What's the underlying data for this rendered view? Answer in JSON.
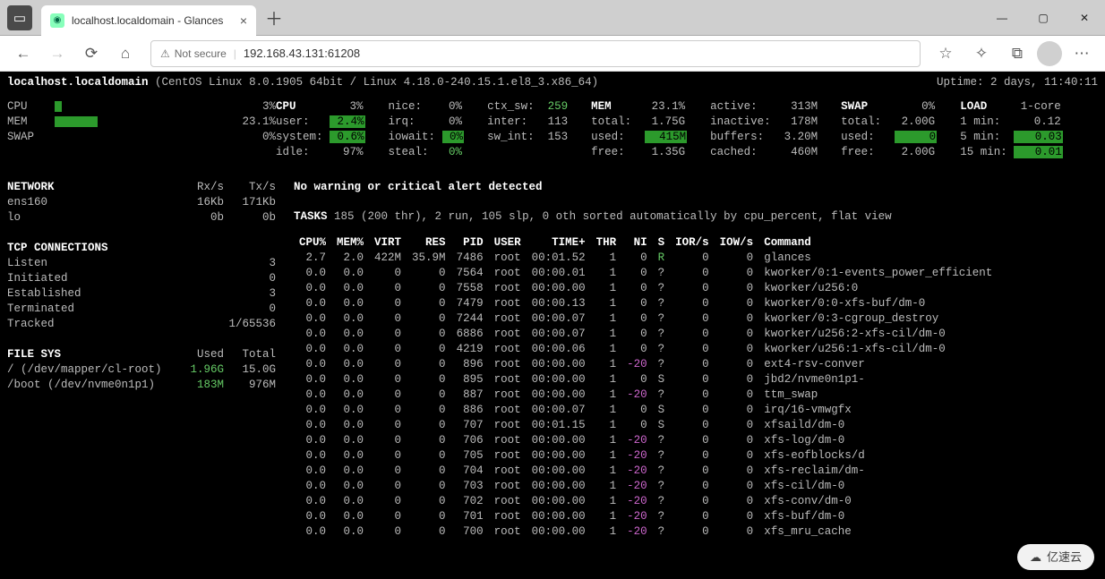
{
  "browser": {
    "tab_title": "localhost.localdomain - Glances",
    "not_secure_label": "Not secure",
    "url": "192.168.43.131:61208"
  },
  "header": {
    "hostname": "localhost.localdomain",
    "os": "(CentOS Linux 8.0.1905 64bit / Linux 4.18.0-240.15.1.el8_3.x86_64)",
    "uptime_label": "Uptime:",
    "uptime_value": "2 days, 11:40:11"
  },
  "summary_left": {
    "cpu_label": "CPU",
    "cpu_pct": "3%",
    "mem_label": "MEM",
    "mem_pct": "23.1%",
    "swap_label": "SWAP",
    "swap_pct": "0%"
  },
  "cpu_block": {
    "title": "CPU",
    "title_val": "3%",
    "rows": [
      {
        "l": "user:",
        "v": "2.4%",
        "hl": true
      },
      {
        "l": "system:",
        "v": "0.6%",
        "hl": true
      },
      {
        "l": "idle:",
        "v": "97%"
      }
    ]
  },
  "cpu_block2": {
    "rows": [
      {
        "l": "nice:",
        "v": "0%"
      },
      {
        "l": "irq:",
        "v": "0%"
      },
      {
        "l": "iowait:",
        "v": "0%",
        "hl": true
      },
      {
        "l": "steal:",
        "v": "0%",
        "green": true
      }
    ]
  },
  "cpu_block3": {
    "rows": [
      {
        "l": "ctx_sw:",
        "v": "259",
        "green": true
      },
      {
        "l": "inter:",
        "v": "113"
      },
      {
        "l": "sw_int:",
        "v": "153"
      }
    ]
  },
  "mem_block": {
    "title": "MEM",
    "title_val": "23.1%",
    "rows": [
      {
        "l": "total:",
        "v": "1.75G"
      },
      {
        "l": "used:",
        "v": "415M",
        "hl": true
      },
      {
        "l": "free:",
        "v": "1.35G"
      }
    ]
  },
  "mem_block2": {
    "rows": [
      {
        "l": "active:",
        "v": "313M"
      },
      {
        "l": "inactive:",
        "v": "178M"
      },
      {
        "l": "buffers:",
        "v": "3.20M"
      },
      {
        "l": "cached:",
        "v": "460M"
      }
    ]
  },
  "swap_block": {
    "title": "SWAP",
    "title_val": "0%",
    "rows": [
      {
        "l": "total:",
        "v": "2.00G"
      },
      {
        "l": "used:",
        "v": "0",
        "hl": true
      },
      {
        "l": "free:",
        "v": "2.00G"
      }
    ]
  },
  "load_block": {
    "title": "LOAD",
    "title_val": "1-core",
    "rows": [
      {
        "l": "1 min:",
        "v": "0.12"
      },
      {
        "l": "5 min:",
        "v": "0.03",
        "hl": true
      },
      {
        "l": "15 min:",
        "v": "0.01",
        "hl": true
      }
    ]
  },
  "network": {
    "title": "NETWORK",
    "col_rx": "Rx/s",
    "col_tx": "Tx/s",
    "rows": [
      {
        "if": "ens160",
        "rx": "16Kb",
        "tx": "171Kb"
      },
      {
        "if": "lo",
        "rx": "0b",
        "tx": "0b"
      }
    ]
  },
  "tcp": {
    "title": "TCP CONNECTIONS",
    "rows": [
      {
        "l": "Listen",
        "v": "3"
      },
      {
        "l": "Initiated",
        "v": "0"
      },
      {
        "l": "Established",
        "v": "3"
      },
      {
        "l": "Terminated",
        "v": "0"
      },
      {
        "l": "Tracked",
        "v": "1/65536"
      }
    ]
  },
  "fs": {
    "title": "FILE SYS",
    "col_used": "Used",
    "col_total": "Total",
    "rows": [
      {
        "mnt": "/ (/dev/mapper/cl-root)",
        "used": "1.96G",
        "used_green": true,
        "total": "15.0G"
      },
      {
        "mnt": "/boot (/dev/nvme0n1p1)",
        "used": "183M",
        "used_green": true,
        "total": "976M"
      }
    ]
  },
  "alert_line": "No warning or critical alert detected",
  "tasks": {
    "label": "TASKS",
    "text": "185 (200 thr), 2 run, 105 slp, 0 oth sorted automatically by cpu_percent, flat view"
  },
  "proc_headers": [
    "CPU%",
    "MEM%",
    "VIRT",
    "RES",
    "PID",
    "USER",
    "TIME+",
    "THR",
    "NI",
    "S",
    "IOR/s",
    "IOW/s",
    "Command"
  ],
  "proc_rows": [
    {
      "cpu": "2.7",
      "mem": "2.0",
      "virt": "422M",
      "res": "35.9M",
      "pid": "7486",
      "user": "root",
      "time": "00:01.52",
      "thr": "1",
      "ni": "0",
      "s": "R",
      "s_green": true,
      "ior": "0",
      "iow": "0",
      "cmd": "glances"
    },
    {
      "cpu": "0.0",
      "mem": "0.0",
      "virt": "0",
      "res": "0",
      "pid": "7564",
      "user": "root",
      "time": "00:00.01",
      "thr": "1",
      "ni": "0",
      "s": "?",
      "ior": "0",
      "iow": "0",
      "cmd": "kworker/0:1-events_power_efficient"
    },
    {
      "cpu": "0.0",
      "mem": "0.0",
      "virt": "0",
      "res": "0",
      "pid": "7558",
      "user": "root",
      "time": "00:00.00",
      "thr": "1",
      "ni": "0",
      "s": "?",
      "ior": "0",
      "iow": "0",
      "cmd": "kworker/u256:0"
    },
    {
      "cpu": "0.0",
      "mem": "0.0",
      "virt": "0",
      "res": "0",
      "pid": "7479",
      "user": "root",
      "time": "00:00.13",
      "thr": "1",
      "ni": "0",
      "s": "?",
      "ior": "0",
      "iow": "0",
      "cmd": "kworker/0:0-xfs-buf/dm-0"
    },
    {
      "cpu": "0.0",
      "mem": "0.0",
      "virt": "0",
      "res": "0",
      "pid": "7244",
      "user": "root",
      "time": "00:00.07",
      "thr": "1",
      "ni": "0",
      "s": "?",
      "ior": "0",
      "iow": "0",
      "cmd": "kworker/0:3-cgroup_destroy"
    },
    {
      "cpu": "0.0",
      "mem": "0.0",
      "virt": "0",
      "res": "0",
      "pid": "6886",
      "user": "root",
      "time": "00:00.07",
      "thr": "1",
      "ni": "0",
      "s": "?",
      "ior": "0",
      "iow": "0",
      "cmd": "kworker/u256:2-xfs-cil/dm-0"
    },
    {
      "cpu": "0.0",
      "mem": "0.0",
      "virt": "0",
      "res": "0",
      "pid": "4219",
      "user": "root",
      "time": "00:00.06",
      "thr": "1",
      "ni": "0",
      "s": "?",
      "ior": "0",
      "iow": "0",
      "cmd": "kworker/u256:1-xfs-cil/dm-0"
    },
    {
      "cpu": "0.0",
      "mem": "0.0",
      "virt": "0",
      "res": "0",
      "pid": "896",
      "user": "root",
      "time": "00:00.00",
      "thr": "1",
      "ni": "-20",
      "ni_mag": true,
      "s": "?",
      "ior": "0",
      "iow": "0",
      "cmd": "ext4-rsv-conver"
    },
    {
      "cpu": "0.0",
      "mem": "0.0",
      "virt": "0",
      "res": "0",
      "pid": "895",
      "user": "root",
      "time": "00:00.00",
      "thr": "1",
      "ni": "0",
      "s": "S",
      "ior": "0",
      "iow": "0",
      "cmd": "jbd2/nvme0n1p1-"
    },
    {
      "cpu": "0.0",
      "mem": "0.0",
      "virt": "0",
      "res": "0",
      "pid": "887",
      "user": "root",
      "time": "00:00.00",
      "thr": "1",
      "ni": "-20",
      "ni_mag": true,
      "s": "?",
      "ior": "0",
      "iow": "0",
      "cmd": "ttm_swap"
    },
    {
      "cpu": "0.0",
      "mem": "0.0",
      "virt": "0",
      "res": "0",
      "pid": "886",
      "user": "root",
      "time": "00:00.07",
      "thr": "1",
      "ni": "0",
      "s": "S",
      "ior": "0",
      "iow": "0",
      "cmd": "irq/16-vmwgfx"
    },
    {
      "cpu": "0.0",
      "mem": "0.0",
      "virt": "0",
      "res": "0",
      "pid": "707",
      "user": "root",
      "time": "00:01.15",
      "thr": "1",
      "ni": "0",
      "s": "S",
      "ior": "0",
      "iow": "0",
      "cmd": "xfsaild/dm-0"
    },
    {
      "cpu": "0.0",
      "mem": "0.0",
      "virt": "0",
      "res": "0",
      "pid": "706",
      "user": "root",
      "time": "00:00.00",
      "thr": "1",
      "ni": "-20",
      "ni_mag": true,
      "s": "?",
      "ior": "0",
      "iow": "0",
      "cmd": "xfs-log/dm-0"
    },
    {
      "cpu": "0.0",
      "mem": "0.0",
      "virt": "0",
      "res": "0",
      "pid": "705",
      "user": "root",
      "time": "00:00.00",
      "thr": "1",
      "ni": "-20",
      "ni_mag": true,
      "s": "?",
      "ior": "0",
      "iow": "0",
      "cmd": "xfs-eofblocks/d"
    },
    {
      "cpu": "0.0",
      "mem": "0.0",
      "virt": "0",
      "res": "0",
      "pid": "704",
      "user": "root",
      "time": "00:00.00",
      "thr": "1",
      "ni": "-20",
      "ni_mag": true,
      "s": "?",
      "ior": "0",
      "iow": "0",
      "cmd": "xfs-reclaim/dm-"
    },
    {
      "cpu": "0.0",
      "mem": "0.0",
      "virt": "0",
      "res": "0",
      "pid": "703",
      "user": "root",
      "time": "00:00.00",
      "thr": "1",
      "ni": "-20",
      "ni_mag": true,
      "s": "?",
      "ior": "0",
      "iow": "0",
      "cmd": "xfs-cil/dm-0"
    },
    {
      "cpu": "0.0",
      "mem": "0.0",
      "virt": "0",
      "res": "0",
      "pid": "702",
      "user": "root",
      "time": "00:00.00",
      "thr": "1",
      "ni": "-20",
      "ni_mag": true,
      "s": "?",
      "ior": "0",
      "iow": "0",
      "cmd": "xfs-conv/dm-0"
    },
    {
      "cpu": "0.0",
      "mem": "0.0",
      "virt": "0",
      "res": "0",
      "pid": "701",
      "user": "root",
      "time": "00:00.00",
      "thr": "1",
      "ni": "-20",
      "ni_mag": true,
      "s": "?",
      "ior": "0",
      "iow": "0",
      "cmd": "xfs-buf/dm-0"
    },
    {
      "cpu": "0.0",
      "mem": "0.0",
      "virt": "0",
      "res": "0",
      "pid": "700",
      "user": "root",
      "time": "00:00.00",
      "thr": "1",
      "ni": "-20",
      "ni_mag": true,
      "s": "?",
      "ior": "0",
      "iow": "0",
      "cmd": "xfs_mru_cache"
    }
  ],
  "watermark": "亿速云"
}
